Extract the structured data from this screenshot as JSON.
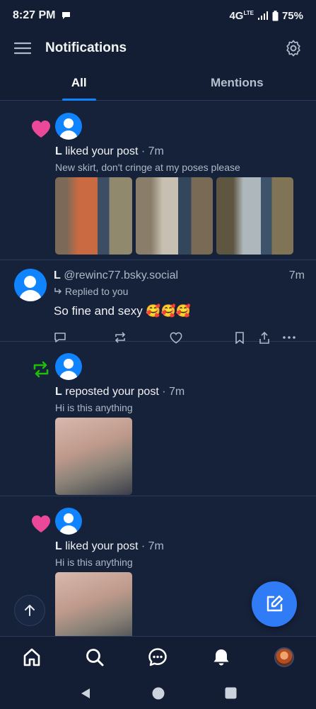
{
  "status_bar": {
    "time": "8:27 PM",
    "network": "4G",
    "lte": "LTE",
    "battery": "75%"
  },
  "header": {
    "title": "Notifications"
  },
  "tabs": [
    {
      "label": "All",
      "active": true
    },
    {
      "label": "Mentions",
      "active": false
    }
  ],
  "notifications": [
    {
      "type": "like",
      "user": "L",
      "action": "liked your post",
      "time": "· 7m",
      "post_text": "New skirt, don't cringe at my poses please"
    },
    {
      "type": "reply",
      "user": "L",
      "handle": "@rewinc77.bsky.social",
      "time": "7m",
      "replied_to": "Replied to you",
      "text": "So fine and sexy 🥰🥰🥰"
    },
    {
      "type": "repost",
      "user": "L",
      "action": "reposted your post",
      "time": "· 7m",
      "post_text": "Hi is this anything"
    },
    {
      "type": "like",
      "user": "L",
      "action": "liked your post",
      "time": "· 7m",
      "post_text": "Hi is this anything"
    }
  ],
  "colors": {
    "background": "#16213a",
    "accent": "#1083fe",
    "like": "#ec4899",
    "repost": "#20bc07"
  },
  "icons": [
    "menu-icon",
    "settings-icon",
    "heart-icon",
    "repost-icon",
    "compose-icon",
    "arrow-up-icon",
    "home-icon",
    "search-icon",
    "chat-icon",
    "bell-icon"
  ]
}
